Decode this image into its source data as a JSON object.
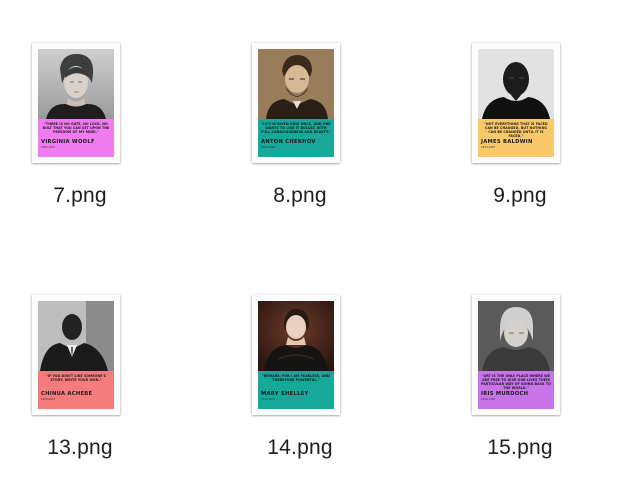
{
  "files": [
    {
      "filename": "7.png",
      "poster": {
        "quote": "\"There is no gate, no lock, no bolt that you can set upon the freedom of my mind.\"",
        "author": "VIRGINIA WOOLF",
        "years": "1882-1941",
        "caption_color": "#f17bf0",
        "portrait_style": "sepia"
      }
    },
    {
      "filename": "8.png",
      "poster": {
        "quote": "\"Life is given only once, and one wants to live it boldly, with full consciousness and beauty.\"",
        "author": "ANTON CHEKHOV",
        "years": "1860-1904",
        "caption_color": "#17a89a",
        "portrait_style": "brown"
      }
    },
    {
      "filename": "9.png",
      "poster": {
        "quote": "\"Not everything that is faced can be changed, but nothing can be changed until it is faced.\"",
        "author": "JAMES BALDWIN",
        "years": "1924-1987",
        "caption_color": "#f8c86a",
        "portrait_style": "bw"
      }
    },
    {
      "filename": "13.png",
      "poster": {
        "quote": "\"If you don't like someone's story, write your own.\"",
        "author": "CHINUA ACHEBE",
        "years": "1930-2013",
        "caption_color": "#f47c7c",
        "portrait_style": "bw"
      }
    },
    {
      "filename": "14.png",
      "poster": {
        "quote": "\"Beware; for I am fearless, and therefore powerful.\"",
        "author": "MARY SHELLEY",
        "years": "1797-1851",
        "caption_color": "#16a999",
        "portrait_style": "painting"
      }
    },
    {
      "filename": "15.png",
      "poster": {
        "quote": "\"Art is the only place where we are free to give our lives their particular way of going back to the world.\"",
        "author": "IRIS MURDOCH",
        "years": "1919-1999",
        "caption_color": "#c873e8",
        "portrait_style": "bw"
      }
    }
  ]
}
